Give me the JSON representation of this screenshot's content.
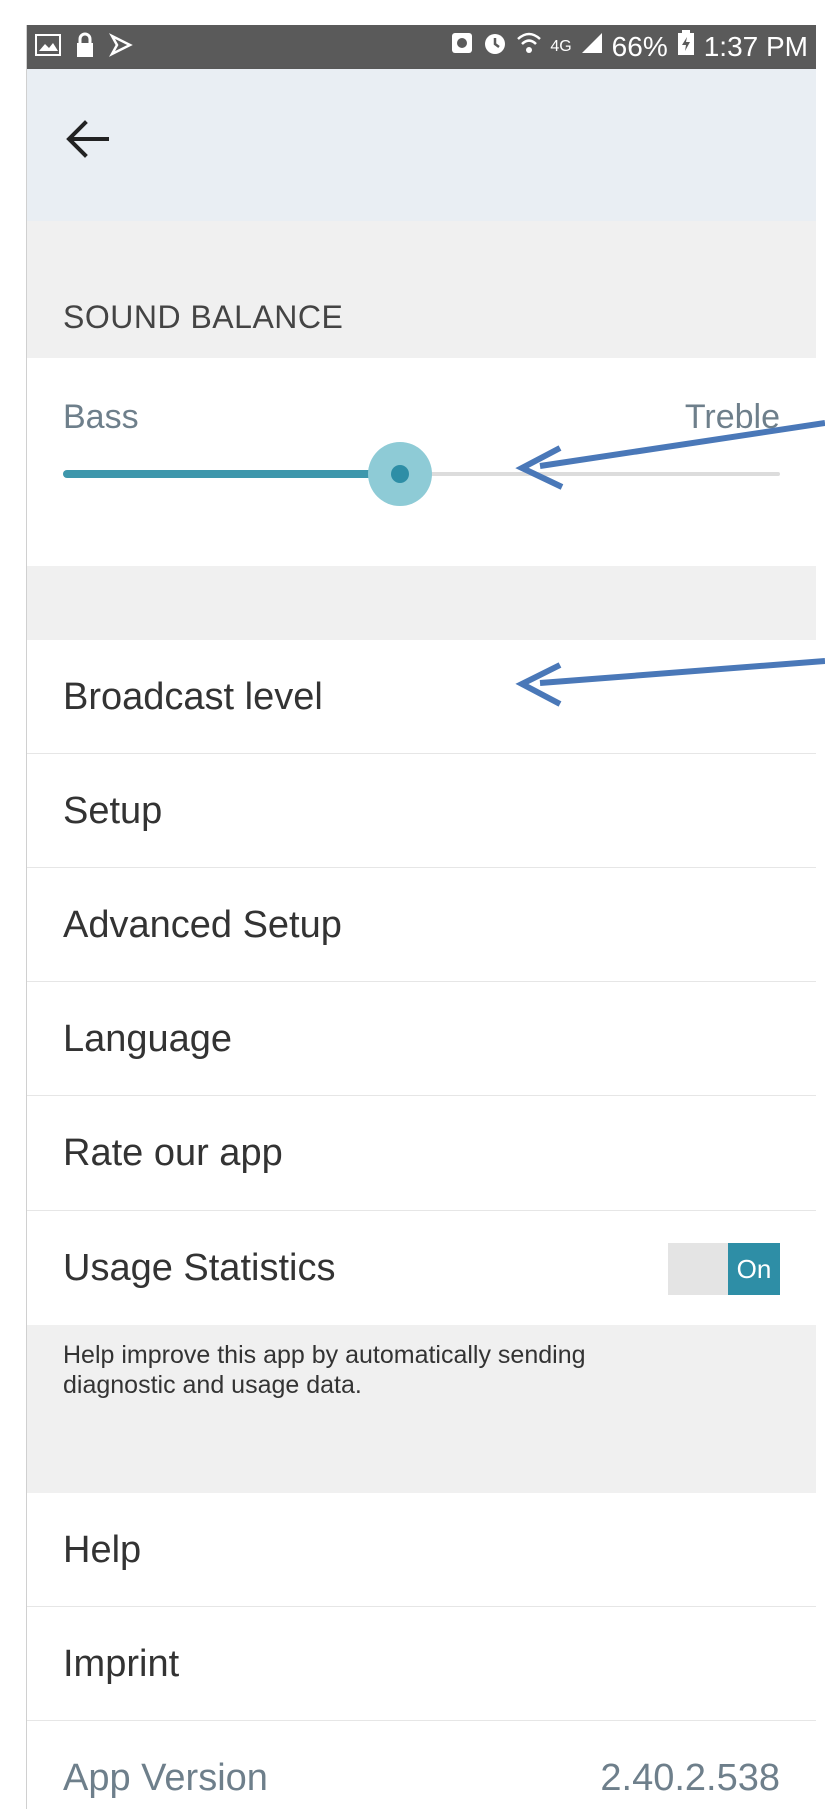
{
  "status_bar": {
    "time": "1:37 PM",
    "battery": "66%",
    "network": "4G",
    "icons": [
      "gallery-icon",
      "lock-icon",
      "cast-icon",
      "nfc-icon",
      "alarm-icon",
      "wifi-icon",
      "signal-icon",
      "battery-icon"
    ]
  },
  "header": {
    "back_icon": "arrow-left-icon"
  },
  "sound_balance": {
    "title": "SOUND BALANCE",
    "min_label": "Bass",
    "max_label": "Treble",
    "value": 0.47
  },
  "settings": {
    "broadcast_level": "Broadcast level",
    "setup": "Setup",
    "advanced_setup": "Advanced Setup",
    "language": "Language",
    "rate_app": "Rate our app",
    "usage_statistics": "Usage Statistics",
    "usage_toggle": "On",
    "usage_help": "Help improve this app by automatically sending diagnostic and usage data.",
    "help": "Help",
    "imprint": "Imprint",
    "app_version_label": "App Version",
    "app_version_value": "2.40.2.538"
  },
  "colors": {
    "accent": "#3e97ac",
    "thumb": "#8ecbd6",
    "app_bar": "#e9eef3",
    "section_bg": "#f0f0f0",
    "annotation_arrow": "#4a78b8"
  }
}
